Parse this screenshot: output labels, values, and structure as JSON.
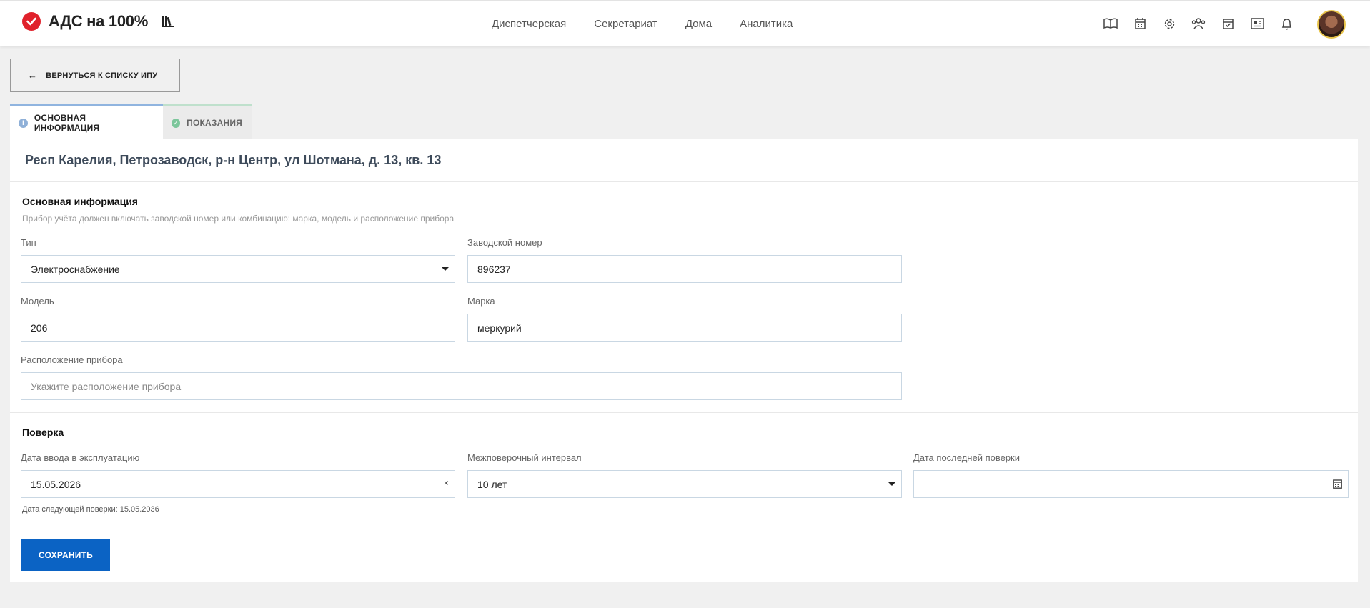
{
  "app": {
    "title": "АДС на 100%",
    "brand_color": "#e0212b"
  },
  "nav": {
    "items": [
      "Диспетчерская",
      "Секретариат",
      "Дома",
      "Аналитика"
    ]
  },
  "toolbar": {
    "icons": [
      "book-open-icon",
      "calendar-grid-icon",
      "gear-icon",
      "users-icon",
      "calendar-check-icon",
      "newspaper-icon",
      "bell-icon"
    ]
  },
  "back_button": {
    "label": "ВЕРНУТЬСЯ К СПИСКУ ИПУ"
  },
  "tabs": [
    {
      "label": "ОСНОВНАЯ ИНФОРМАЦИЯ",
      "icon": "info-icon",
      "active": true,
      "accent": "#90b4df"
    },
    {
      "label": "ПОКАЗАНИЯ",
      "icon": "check-circle-icon",
      "active": false,
      "accent": "#bfe0cc"
    }
  ],
  "address": "Респ Карелия, Петрозаводск, р-н Центр, ул Шотмана, д. 13, кв. 13",
  "main_info": {
    "title": "Основная информация",
    "hint": "Прибор учёта должен включать заводской номер или комбинацию: марка, модель и расположение прибора",
    "type": {
      "label": "Тип",
      "value": "Электроснабжение"
    },
    "serial": {
      "label": "Заводской номер",
      "value": "896237"
    },
    "model": {
      "label": "Модель",
      "value": "206"
    },
    "brand": {
      "label": "Марка",
      "value": "меркурий"
    },
    "location": {
      "label": "Расположение прибора",
      "placeholder": "Укажите расположение прибора"
    }
  },
  "verification": {
    "title": "Поверка",
    "commission_date": {
      "label": "Дата ввода в эксплуатацию",
      "value": "15.05.2026"
    },
    "interval": {
      "label": "Межповерочный интервал",
      "value": "10 лет"
    },
    "last_check": {
      "label": "Дата последней поверки",
      "value": ""
    },
    "next_check_text": "Дата следующей поверки: 15.05.2036"
  },
  "save_button": {
    "label": "СОХРАНИТЬ",
    "color": "#0b63c4"
  }
}
